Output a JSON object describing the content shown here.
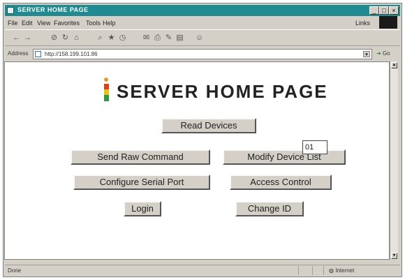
{
  "window": {
    "title": "SERVER HOME PAGE"
  },
  "menu": [
    "File",
    "Edit",
    "View",
    "Favorites",
    "Tools",
    "Help"
  ],
  "links_label": "Links",
  "toolbar_icons": [
    "back-icon",
    "forward-icon",
    "stop-icon",
    "refresh-icon",
    "home-icon",
    "search-icon",
    "favorites-icon",
    "history-icon",
    "mail-icon",
    "print-icon",
    "edit-icon",
    "discuss-icon",
    "messenger-icon"
  ],
  "address": {
    "label": "Address",
    "url": "http://158.199.101.86",
    "go_label": "Go"
  },
  "page": {
    "title": "SERVER HOME PAGE",
    "buttons": {
      "read_devices": "Read Devices",
      "send_raw": "Send Raw Command",
      "modify_list": "Modify Device List",
      "config_serial": "Configure Serial Port",
      "access_control": "Access Control",
      "login": "Login",
      "change_id": "Change ID"
    },
    "id_value": "01"
  },
  "status": {
    "text": "Done",
    "zone": "Internet"
  },
  "colors": {
    "titlebar": "#1f8a8f",
    "chrome": "#d4d0c8"
  }
}
